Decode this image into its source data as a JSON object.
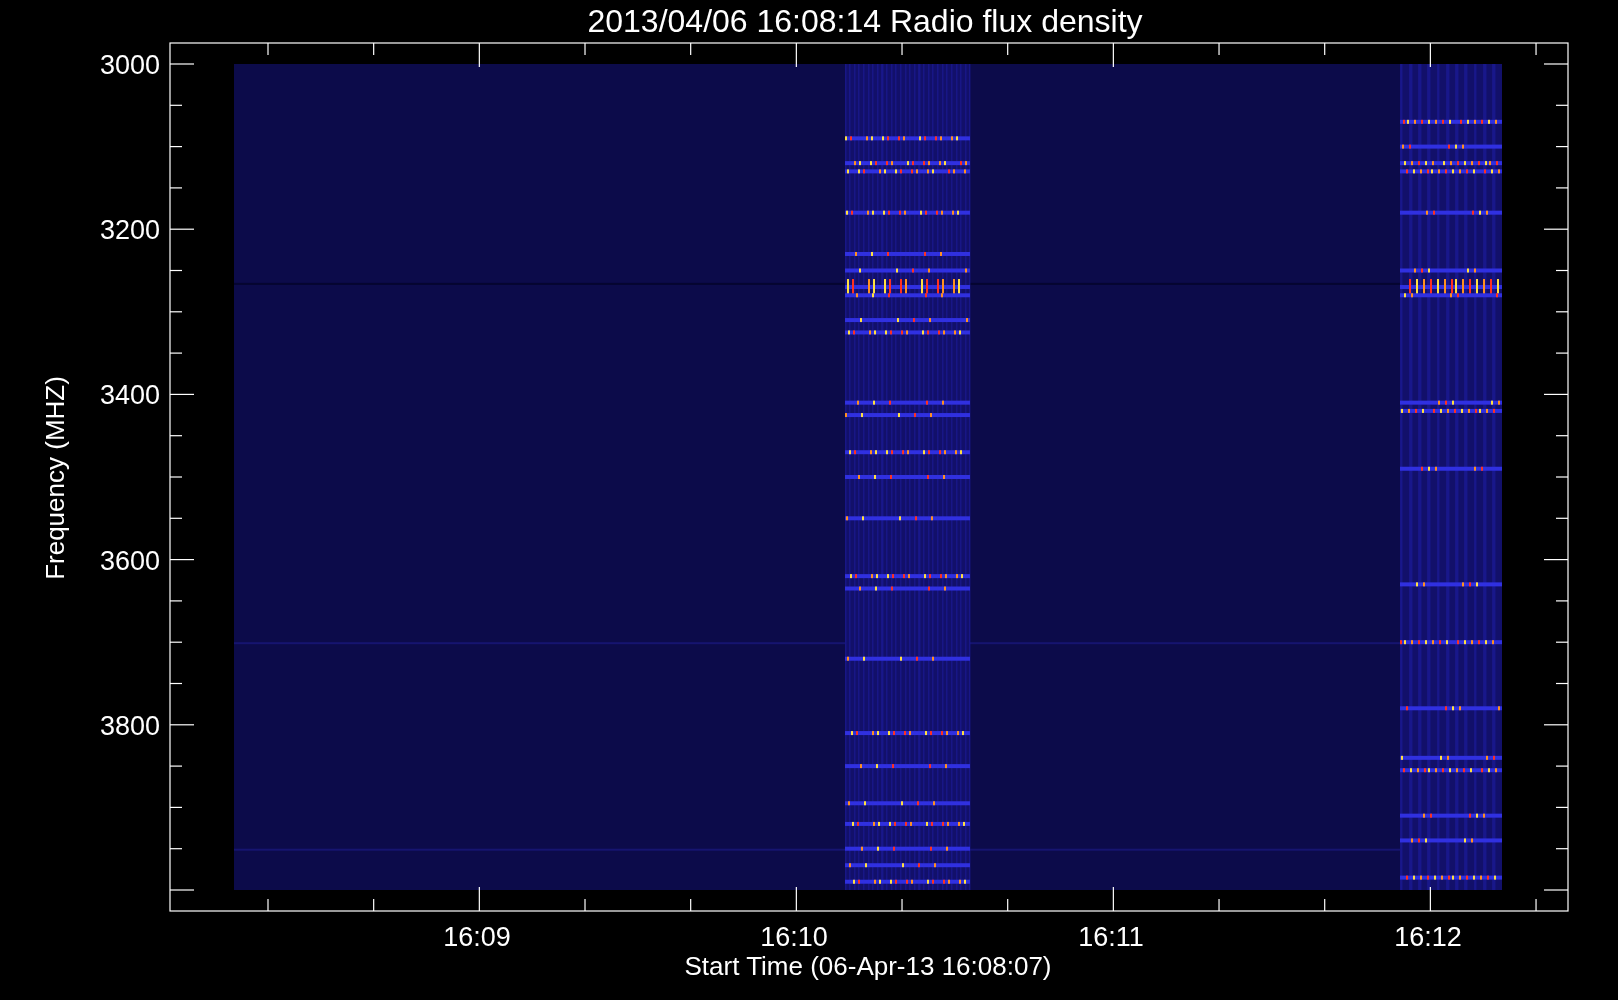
{
  "title": "2013/04/06 16:08:14 Radio flux density",
  "y_axis": {
    "label": "Frequency (MHZ)",
    "ticks": [
      "3000",
      "3200",
      "3400",
      "3600",
      "3800"
    ]
  },
  "x_axis": {
    "label": "Start Time (06-Apr-13 16:08:07)",
    "ticks": [
      "16:09",
      "16:10",
      "16:11",
      "16:12"
    ]
  }
}
